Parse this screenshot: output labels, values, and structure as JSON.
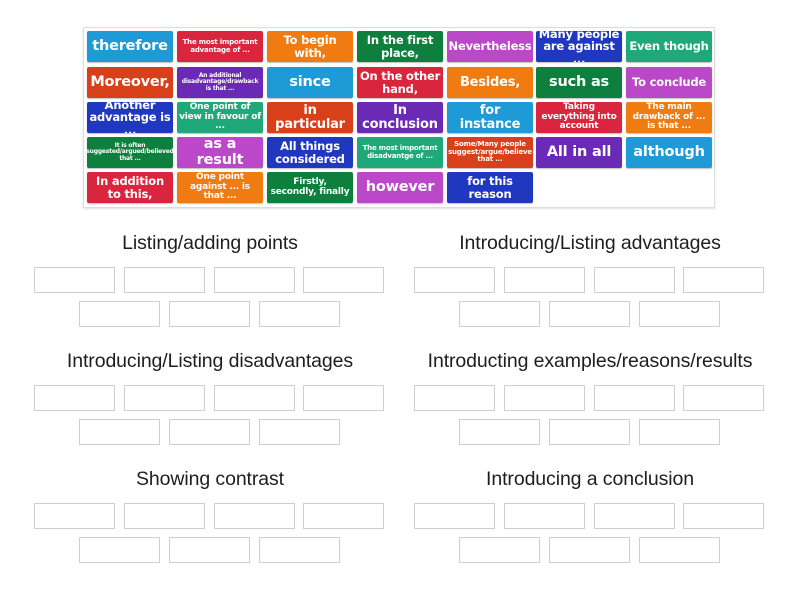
{
  "tiles": [
    {
      "label": "therefore",
      "color": "#1e9ad6",
      "size": "xl"
    },
    {
      "label": "The most important advantage of ...",
      "color": "#d9253d",
      "size": "xs"
    },
    {
      "label": "To begin with,",
      "color": "#f07b10",
      "size": "m"
    },
    {
      "label": "In the first place,",
      "color": "#0f7f3d",
      "size": "m"
    },
    {
      "label": "Nevertheless",
      "color": "#bb47c9",
      "size": "m"
    },
    {
      "label": "Many people are against ...",
      "color": "#2038c0",
      "size": "m"
    },
    {
      "label": "Even though",
      "color": "#1fa87a",
      "size": "m"
    },
    {
      "label": "Moreover,",
      "color": "#d8401a",
      "size": "xl"
    },
    {
      "label": "An additional disadvantage/drawback is that ...",
      "color": "#6a2ab5",
      "size": "xxs"
    },
    {
      "label": "since",
      "color": "#1e9ad6",
      "size": "xl"
    },
    {
      "label": "On the other hand,",
      "color": "#d9253d",
      "size": "m"
    },
    {
      "label": "Besides,",
      "color": "#f07b10",
      "size": "l"
    },
    {
      "label": "such as",
      "color": "#0f7f3d",
      "size": "xl"
    },
    {
      "label": "To conclude",
      "color": "#bb47c9",
      "size": "m"
    },
    {
      "label": "Another advantage is ...",
      "color": "#2038c0",
      "size": "m"
    },
    {
      "label": "One point of view in favour of ...",
      "color": "#1fa87a",
      "size": "s"
    },
    {
      "label": "in particular",
      "color": "#d8401a",
      "size": "l"
    },
    {
      "label": "In conclusion",
      "color": "#6a2ab5",
      "size": "l"
    },
    {
      "label": "for instance",
      "color": "#1e9ad6",
      "size": "l"
    },
    {
      "label": "Taking everything into account",
      "color": "#d9253d",
      "size": "s"
    },
    {
      "label": "The main drawback of ... is that ...",
      "color": "#f07b10",
      "size": "s"
    },
    {
      "label": "It is often suggested/argued/believed that ...",
      "color": "#0f7f3d",
      "size": "xxs"
    },
    {
      "label": "as a result",
      "color": "#bb47c9",
      "size": "xl"
    },
    {
      "label": "All things considered",
      "color": "#2038c0",
      "size": "m"
    },
    {
      "label": "The most important disadvantge of ...",
      "color": "#1fa87a",
      "size": "xs"
    },
    {
      "label": "Some/Many people suggest/argue/believe that ...",
      "color": "#d8401a",
      "size": "xs"
    },
    {
      "label": "All in all",
      "color": "#6a2ab5",
      "size": "xl"
    },
    {
      "label": "although",
      "color": "#1e9ad6",
      "size": "xl"
    },
    {
      "label": "In addition to this,",
      "color": "#d9253d",
      "size": "m"
    },
    {
      "label": "One point against ... is that ...",
      "color": "#f07b10",
      "size": "s"
    },
    {
      "label": "Firstly, secondly, finally",
      "color": "#0f7f3d",
      "size": "s"
    },
    {
      "label": "however",
      "color": "#bb47c9",
      "size": "xl"
    },
    {
      "label": "for this reason",
      "color": "#2038c0",
      "size": "m"
    }
  ],
  "groups": [
    {
      "title": "Listing/adding points"
    },
    {
      "title": "Introducing/Listing advantages"
    },
    {
      "title": "Introducing/Listing disadvantages"
    },
    {
      "title": "Introducting examples/reasons/results"
    },
    {
      "title": "Showing contrast"
    },
    {
      "title": "Introducing a conclusion"
    }
  ]
}
